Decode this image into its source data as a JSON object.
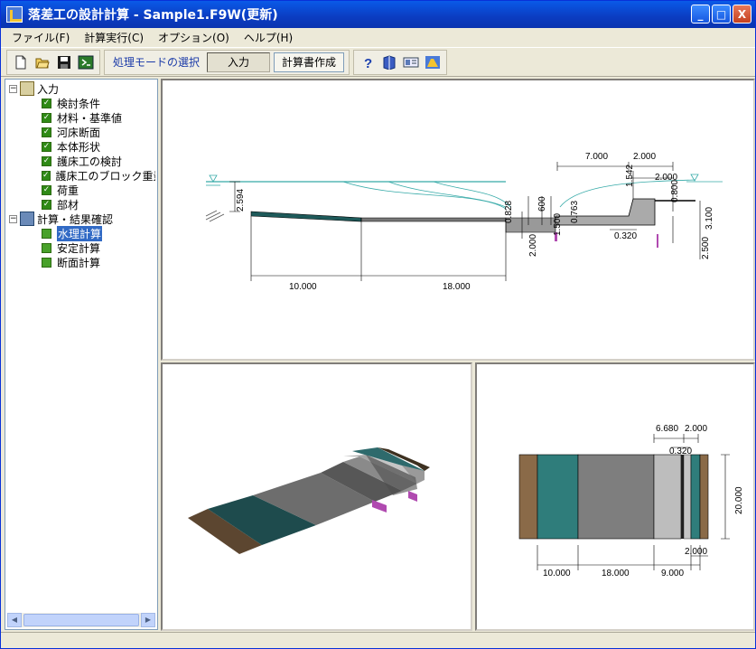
{
  "window": {
    "title": "落差工の設計計算 - Sample1.F9W(更新)"
  },
  "title_buttons": {
    "minimize": "_",
    "maximize": "□",
    "close": "X"
  },
  "menu": [
    "ファイル(F)",
    "計算実行(C)",
    "オプション(O)",
    "ヘルプ(H)"
  ],
  "toolbar": {
    "mode_label": "処理モードの選択",
    "input_btn": "入力",
    "report_btn": "計算書作成"
  },
  "tree": {
    "input_root": "入力",
    "input_items": [
      "検討条件",
      "材料・基準値",
      "河床断面",
      "本体形状",
      "護床工の検討",
      "護床工のブロック重量",
      "荷重",
      "部材"
    ],
    "calc_root": "計算・結果確認",
    "calc_items": [
      "水理計算",
      "安定計算",
      "断面計算"
    ]
  },
  "section_view": {
    "dims": {
      "d7000": "7.000",
      "d2000_top": "2.000",
      "d2000_b": "2.000",
      "d1542": "1.542",
      "d0800": "0.800",
      "d3100": "3.100",
      "d2594": "2.594",
      "d0828": "0.828",
      "d600": "600",
      "d0763": "0.763",
      "d1500": "1.500",
      "d0320": "0.320",
      "d2000_v": "2.000",
      "d2500": "2.500",
      "d10000": "10.000",
      "d18000": "18.000"
    }
  },
  "plan_view": {
    "dims": {
      "d6680": "6.680",
      "d2000_t": "2.000",
      "d0320": "0.320",
      "d20000": "20.000",
      "d2000_b": "2.000",
      "d10000": "10.000",
      "d18000": "18.000",
      "d9000": "9.000"
    }
  }
}
